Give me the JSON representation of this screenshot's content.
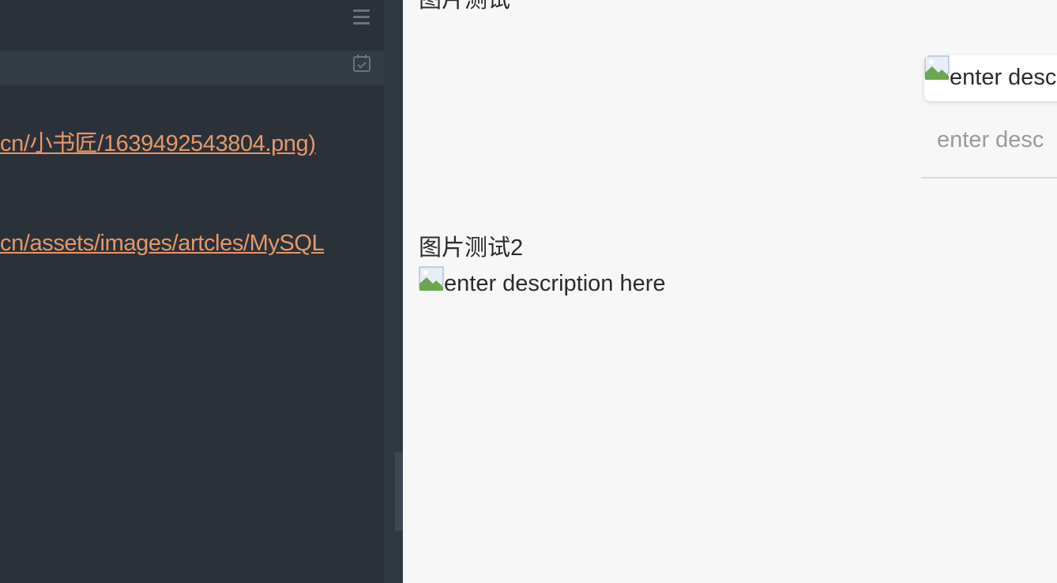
{
  "editor": {
    "lines": [
      "cn/小书匠/1639492543804.png)",
      "cn/assets/images/artcles/MySQL"
    ],
    "link_color": "#e5976a",
    "background": "#2b3138"
  },
  "preview": {
    "heading_cut": "图片测试",
    "heading2": "图片测试2",
    "image_alt": "enter description here",
    "card_alt": "enter desc",
    "caption_placeholder": "enter desc"
  },
  "icons": {
    "menu": "hamburger-menu-icon",
    "calendar": "calendar-check-icon",
    "broken_image": "broken-image-icon"
  }
}
